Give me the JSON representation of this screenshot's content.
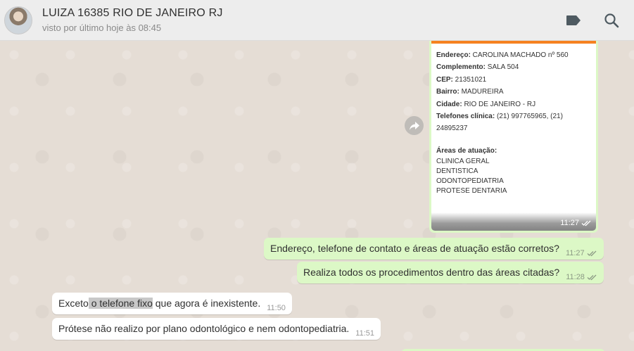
{
  "header": {
    "contact_name": "LUIZA 16385 RIO DE JANEIRO RJ",
    "status": "visto por último hoje às 08:45",
    "icons": [
      "label-icon",
      "search-icon"
    ]
  },
  "card": {
    "lines": [
      {
        "label": "Endereço:",
        "value": " CAROLINA MACHADO nº 560"
      },
      {
        "label": "Complemento:",
        "value": " SALA 504"
      },
      {
        "label": "CEP:",
        "value": " 21351021"
      },
      {
        "label": "Bairro:",
        "value": " MADUREIRA"
      },
      {
        "label": "Cidade:",
        "value": " RIO DE JANEIRO - RJ"
      },
      {
        "label": "Telefones clínica:",
        "value": " (21) 997765965, (21)"
      }
    ],
    "phone_cont": "24895237",
    "areas_title": "Áreas de atuação:",
    "areas": [
      "CLINICA GERAL",
      "DENTISTICA",
      "ODONTOPEDIATRIA",
      "PROTESE DENTARIA"
    ],
    "time": "11:27"
  },
  "messages": [
    {
      "dir": "out",
      "text": "Endereço, telefone de contato e áreas de atuação estão corretos?",
      "time": "11:27"
    },
    {
      "dir": "out",
      "text": "Realiza todos os procedimentos dentro das áreas citadas?",
      "time": "11:28"
    },
    {
      "dir": "in",
      "text_before": "Exceto",
      "text_highlight": " o telefone fixo",
      "text_after": " que agora é inexistente.",
      "time": "11:50"
    },
    {
      "dir": "in",
      "text": "Prótese não realizo por plano odontológico e nem odontopediatria.",
      "time": "11:51"
    }
  ],
  "colors": {
    "outgoing_bubble": "#dcf8c6",
    "incoming_bubble": "#ffffff",
    "chat_background": "#e5ddd5",
    "card_accent": "#f58220",
    "read_ticks": "#8c9a85"
  }
}
